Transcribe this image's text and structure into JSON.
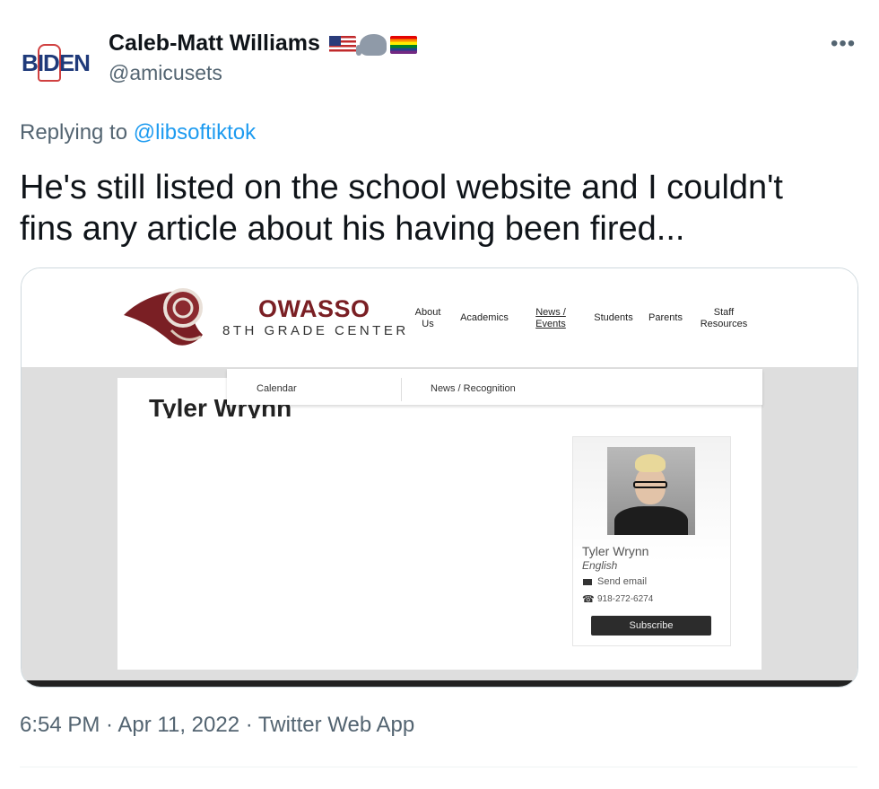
{
  "tweet": {
    "avatar_text": "BIDEN",
    "display_name": "Caleb-Matt Williams",
    "emojis": [
      "us-flag-emoji",
      "elephant-emoji",
      "rainbow-flag-emoji"
    ],
    "handle": "@amicusets",
    "more_label": "•••",
    "reply_prefix": "Replying to",
    "reply_mention": "@libsoftiktok",
    "text": "He's still listed on the school website and I couldn't fins any article about his having been fired...",
    "timestamp": "6:54 PM · Apr 11, 2022 · Twitter Web App"
  },
  "embedded_site": {
    "school_name": "OWASSO",
    "school_subtitle": "8TH GRADE CENTER",
    "nav": {
      "about": "About Us",
      "academics": "Academics",
      "news": "News / Events",
      "students": "Students",
      "parents": "Parents",
      "staff": "Staff Resources"
    },
    "dropdown": {
      "calendar": "Calendar",
      "news_recognition": "News / Recognition"
    },
    "page_title": "Tyler Wrynn",
    "profile": {
      "name": "Tyler Wrynn",
      "department": "English",
      "email_label": "Send email",
      "phone": "918-272-6274",
      "subscribe_label": "Subscribe"
    }
  },
  "colors": {
    "text_primary": "#0f1419",
    "text_secondary": "#536471",
    "link": "#1d9bf0",
    "school_maroon": "#7a1f24"
  }
}
